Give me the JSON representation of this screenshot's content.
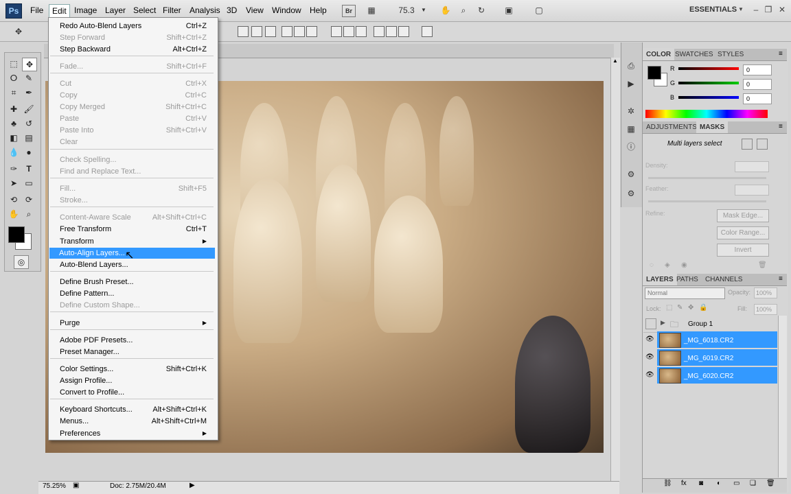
{
  "menubar": {
    "logo": "Ps",
    "items": [
      "File",
      "Edit",
      "Image",
      "Layer",
      "Select",
      "Filter",
      "Analysis",
      "3D",
      "View",
      "Window",
      "Help"
    ],
    "br_label": "Br",
    "zoom": "75.3",
    "workspace": "ESSENTIALS"
  },
  "edit_menu": {
    "items": [
      {
        "label": "Redo Auto-Blend Layers",
        "shortcut": "Ctrl+Z",
        "disabled": false
      },
      {
        "label": "Step Forward",
        "shortcut": "Shift+Ctrl+Z",
        "disabled": true
      },
      {
        "label": "Step Backward",
        "shortcut": "Alt+Ctrl+Z",
        "disabled": false
      },
      {
        "label": "Fade...",
        "shortcut": "Shift+Ctrl+F",
        "disabled": true
      },
      {
        "label": "Cut",
        "shortcut": "Ctrl+X",
        "disabled": true
      },
      {
        "label": "Copy",
        "shortcut": "Ctrl+C",
        "disabled": true
      },
      {
        "label": "Copy Merged",
        "shortcut": "Shift+Ctrl+C",
        "disabled": true
      },
      {
        "label": "Paste",
        "shortcut": "Ctrl+V",
        "disabled": true
      },
      {
        "label": "Paste Into",
        "shortcut": "Shift+Ctrl+V",
        "disabled": true
      },
      {
        "label": "Clear",
        "shortcut": "",
        "disabled": true
      },
      {
        "label": "Check Spelling...",
        "shortcut": "",
        "disabled": true
      },
      {
        "label": "Find and Replace Text...",
        "shortcut": "",
        "disabled": true
      },
      {
        "label": "Fill...",
        "shortcut": "Shift+F5",
        "disabled": true
      },
      {
        "label": "Stroke...",
        "shortcut": "",
        "disabled": true
      },
      {
        "label": "Content-Aware Scale",
        "shortcut": "Alt+Shift+Ctrl+C",
        "disabled": true
      },
      {
        "label": "Free Transform",
        "shortcut": "Ctrl+T",
        "disabled": false
      },
      {
        "label": "Transform",
        "shortcut": "",
        "disabled": false
      },
      {
        "label": "Auto-Align Layers...",
        "shortcut": "",
        "disabled": false
      },
      {
        "label": "Auto-Blend Layers...",
        "shortcut": "",
        "disabled": false
      },
      {
        "label": "Define Brush Preset...",
        "shortcut": "",
        "disabled": false
      },
      {
        "label": "Define Pattern...",
        "shortcut": "",
        "disabled": false
      },
      {
        "label": "Define Custom Shape...",
        "shortcut": "",
        "disabled": true
      },
      {
        "label": "Purge",
        "shortcut": "",
        "disabled": false
      },
      {
        "label": "Adobe PDF Presets...",
        "shortcut": "",
        "disabled": false
      },
      {
        "label": "Preset Manager...",
        "shortcut": "",
        "disabled": false
      },
      {
        "label": "Color Settings...",
        "shortcut": "Shift+Ctrl+K",
        "disabled": false
      },
      {
        "label": "Assign Profile...",
        "shortcut": "",
        "disabled": false
      },
      {
        "label": "Convert to Profile...",
        "shortcut": "",
        "disabled": false
      },
      {
        "label": "Keyboard Shortcuts...",
        "shortcut": "Alt+Shift+Ctrl+K",
        "disabled": false
      },
      {
        "label": "Menus...",
        "shortcut": "Alt+Shift+Ctrl+M",
        "disabled": false
      },
      {
        "label": "Preferences",
        "shortcut": "",
        "disabled": false
      }
    ]
  },
  "color_panel": {
    "tabs": [
      "COLOR",
      "SWATCHES",
      "STYLES"
    ],
    "channels": [
      {
        "name": "R",
        "value": "0",
        "color": "#e00000"
      },
      {
        "name": "G",
        "value": "0",
        "color": "#00b000"
      },
      {
        "name": "B",
        "value": "0",
        "color": "#0000e0"
      }
    ]
  },
  "adjust_panel": {
    "tabs": [
      "ADJUSTMENTS",
      "MASKS"
    ],
    "status": "Multi layers select",
    "density_label": "Density:",
    "feather_label": "Feather:",
    "refine_label": "Refine:",
    "buttons": [
      "Mask Edge...",
      "Color Range...",
      "Invert"
    ]
  },
  "layers_panel": {
    "tabs": [
      "LAYERS",
      "PATHS",
      "CHANNELS"
    ],
    "blend_mode": "Normal",
    "opacity_label": "Opacity:",
    "opacity": "100%",
    "lock_label": "Lock:",
    "fill_label": "Fill:",
    "fill": "100%",
    "group": "Group 1",
    "layers": [
      "_MG_6018.CR2",
      "_MG_6019.CR2",
      "_MG_6020.CR2"
    ]
  },
  "status": {
    "zoom": "75.25%",
    "doc": "Doc: 2.75M/20.4M"
  },
  "colors": {
    "highlight": "#3399ff",
    "panel_bg": "#d6d6d6"
  }
}
